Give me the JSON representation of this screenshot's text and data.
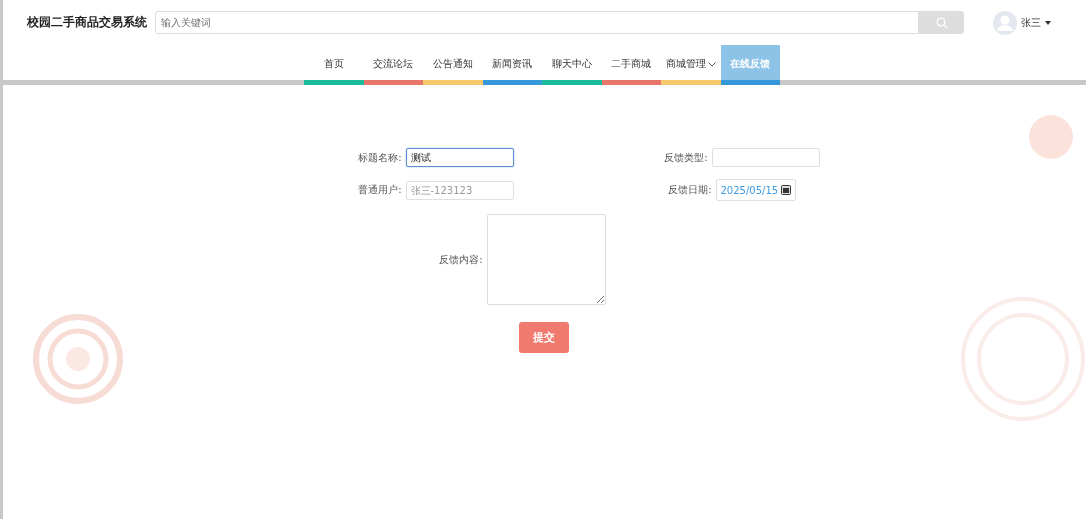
{
  "header": {
    "title": "校园二手商品交易系统",
    "search": {
      "placeholder": "输入关键词"
    },
    "user": {
      "name": "张三"
    }
  },
  "nav": [
    {
      "label": "首页",
      "color": "#1abc9c",
      "selected": false,
      "dropdown": false
    },
    {
      "label": "交流论坛",
      "color": "#e8756a",
      "selected": false,
      "dropdown": false
    },
    {
      "label": "公告通知",
      "color": "#f7c96a",
      "selected": false,
      "dropdown": false
    },
    {
      "label": "新闻资讯",
      "color": "#3498db",
      "selected": false,
      "dropdown": false
    },
    {
      "label": "聊天中心",
      "color": "#1abc9c",
      "selected": false,
      "dropdown": false
    },
    {
      "label": "二手商城",
      "color": "#e8756a",
      "selected": false,
      "dropdown": false
    },
    {
      "label": "商城管理",
      "color": "#f7c96a",
      "selected": false,
      "dropdown": true
    },
    {
      "label": "在线反馈",
      "color": "#3498db",
      "selected": true,
      "dropdown": false
    }
  ],
  "form": {
    "fields": [
      {
        "label": "标题名称:",
        "value": "测试",
        "focused": true
      },
      {
        "label": "反馈类型:",
        "focused": false
      },
      {
        "label": "普通用户:",
        "placeholder": "张三-123123",
        "focused": false
      },
      {
        "label": "反馈日期:",
        "value": "2025/05/15",
        "kind": "date",
        "focused": false
      }
    ],
    "content": {
      "label": "反馈内容:"
    },
    "submit": "提交"
  }
}
